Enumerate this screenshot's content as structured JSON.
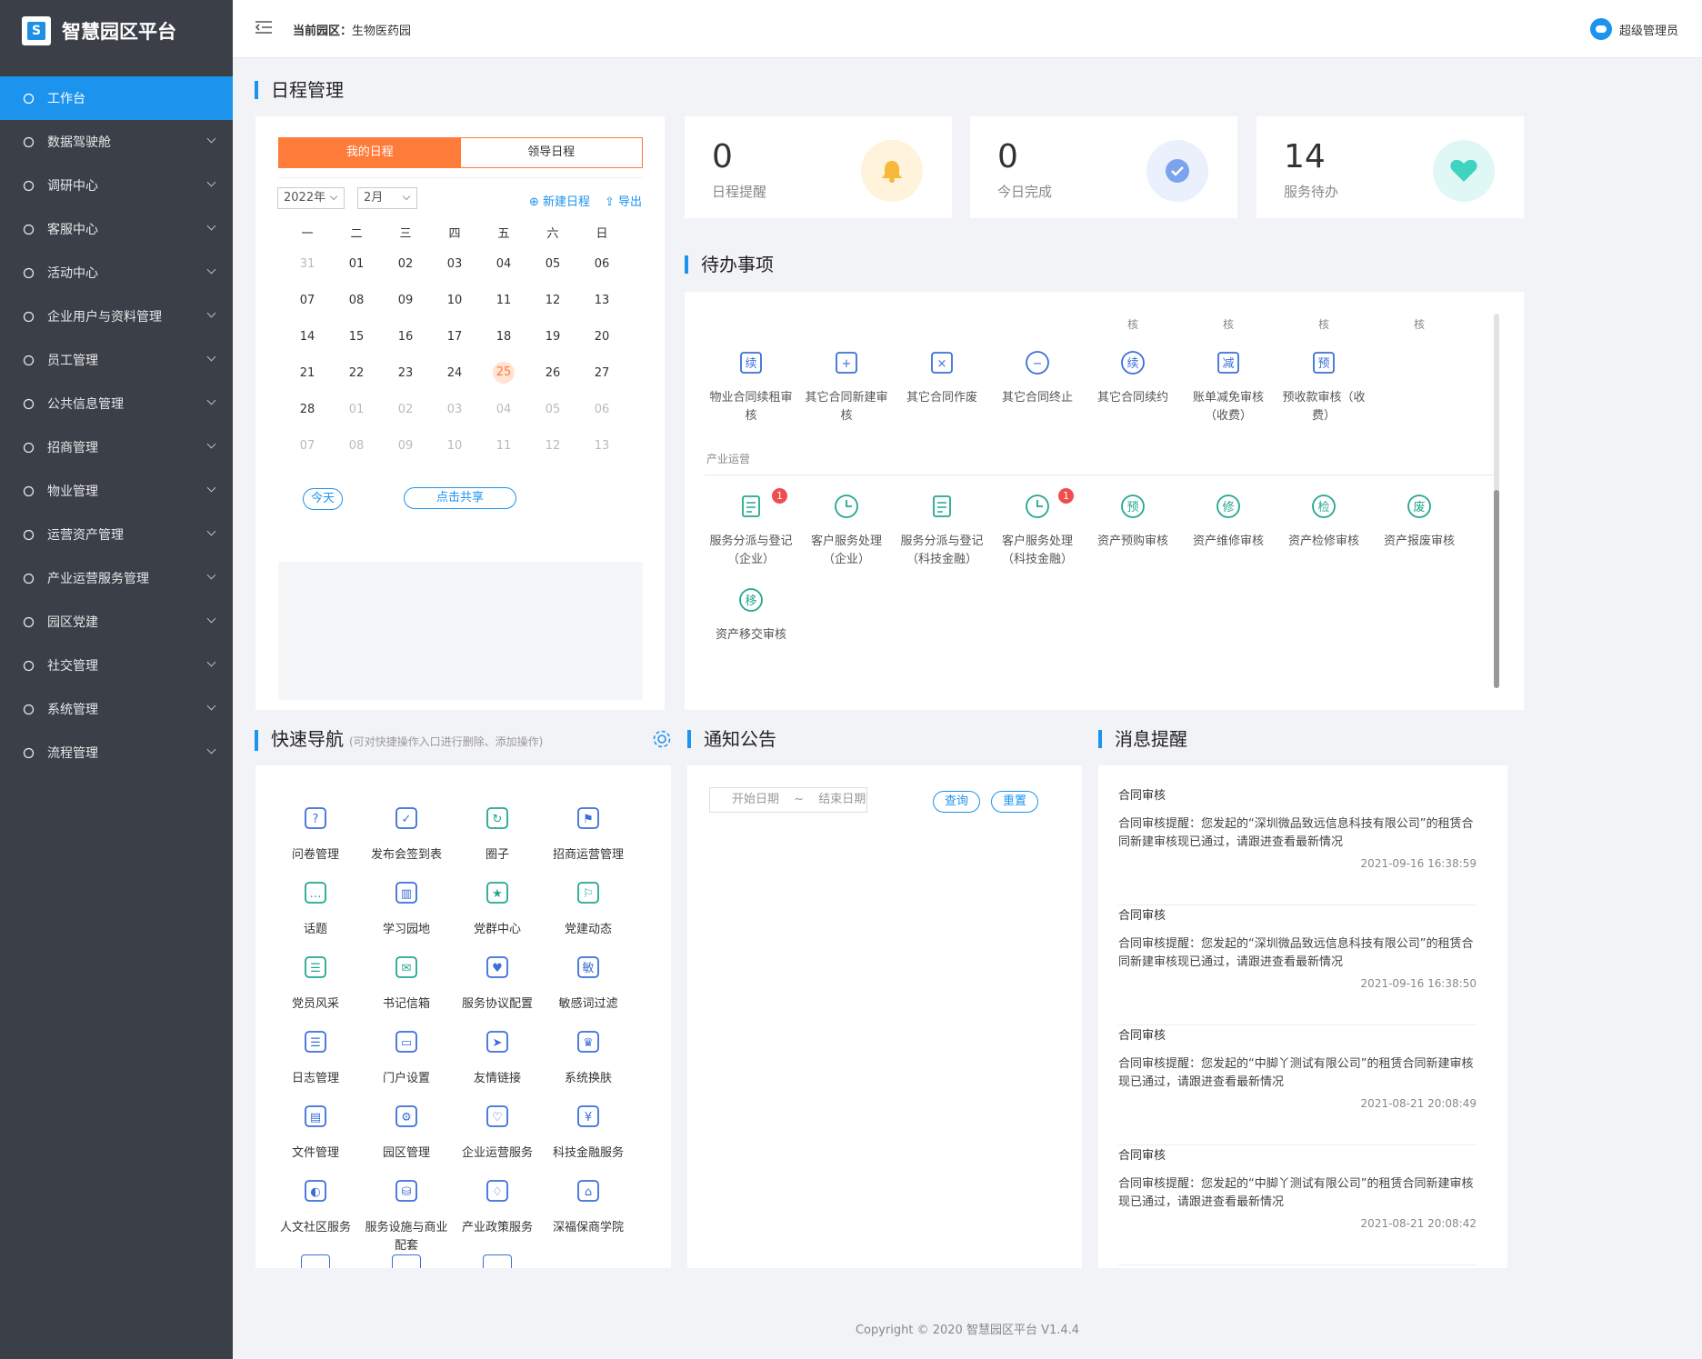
{
  "app": {
    "title": "智慧园区平台",
    "logo_letter": "S"
  },
  "sidebar": {
    "items": [
      {
        "label": "工作台",
        "icon": "dashboard-icon",
        "active": true
      },
      {
        "label": "数据驾驶舱",
        "icon": "bar-chart-icon"
      },
      {
        "label": "调研中心",
        "icon": "search-icon"
      },
      {
        "label": "客服中心",
        "icon": "headset-icon"
      },
      {
        "label": "活动中心",
        "icon": "fire-icon"
      },
      {
        "label": "企业用户与资料管理",
        "icon": "users-icon"
      },
      {
        "label": "员工管理",
        "icon": "user-group-icon"
      },
      {
        "label": "公共信息管理",
        "icon": "network-icon"
      },
      {
        "label": "招商管理",
        "icon": "pie-icon"
      },
      {
        "label": "物业管理",
        "icon": "home-icon"
      },
      {
        "label": "运营资产管理",
        "icon": "coin-icon"
      },
      {
        "label": "产业运营服务管理",
        "icon": "document-icon"
      },
      {
        "label": "园区党建",
        "icon": "org-icon"
      },
      {
        "label": "社交管理",
        "icon": "share-icon"
      },
      {
        "label": "系统管理",
        "icon": "gear-icon"
      },
      {
        "label": "流程管理",
        "icon": "flow-icon"
      }
    ]
  },
  "header": {
    "park_label": "当前园区：",
    "park_name": "生物医药园",
    "user": "超级管理员"
  },
  "schedule": {
    "title": "日程管理",
    "tabs": [
      "我的日程",
      "领导日程"
    ],
    "year": "2022年",
    "month": "2月",
    "new_label": "新建日程",
    "export_label": "导出",
    "weekdays": [
      "一",
      "二",
      "三",
      "四",
      "五",
      "六",
      "日"
    ],
    "weeks": [
      [
        "31",
        "01",
        "02",
        "03",
        "04",
        "05",
        "06"
      ],
      [
        "07",
        "08",
        "09",
        "10",
        "11",
        "12",
        "13"
      ],
      [
        "14",
        "15",
        "16",
        "17",
        "18",
        "19",
        "20"
      ],
      [
        "21",
        "22",
        "23",
        "24",
        "25",
        "26",
        "27"
      ],
      [
        "28",
        "01",
        "02",
        "03",
        "04",
        "05",
        "06"
      ],
      [
        "07",
        "08",
        "09",
        "10",
        "11",
        "12",
        "13"
      ]
    ],
    "today": "25",
    "today_btn": "今天",
    "share_btn": "点击共享"
  },
  "stats": [
    {
      "num": "0",
      "label": "日程提醒",
      "color": "#fff3dc",
      "icon": "bell-icon",
      "iconColor": "#f6b93b"
    },
    {
      "num": "0",
      "label": "今日完成",
      "color": "#eaf1fd",
      "icon": "check-icon",
      "iconColor": "#7ca4ee"
    },
    {
      "num": "14",
      "label": "服务待办",
      "color": "#e0f8f5",
      "icon": "heart-icon",
      "iconColor": "#3fd3c0"
    }
  ],
  "todo": {
    "title": "待办事项",
    "top_labels": [
      "核",
      "核",
      "核",
      "核"
    ],
    "row1": [
      {
        "label": "物业合同续租审核",
        "glyph": "续"
      },
      {
        "label": "其它合同新建审核",
        "glyph": "+"
      },
      {
        "label": "其它合同作废",
        "glyph": "×"
      },
      {
        "label": "其它合同终止",
        "glyph": "−"
      },
      {
        "label": "其它合同续约",
        "glyph": "续"
      },
      {
        "label": "账单减免审核（收费）",
        "glyph": "减"
      },
      {
        "label": "预收款审核（收费）",
        "glyph": "预"
      }
    ],
    "group2": "产业运营",
    "row2": [
      {
        "label": "服务分派与登记（企业）",
        "badge": "1"
      },
      {
        "label": "客户服务处理（企业）"
      },
      {
        "label": "服务分派与登记（科技金融）"
      },
      {
        "label": "客户服务处理（科技金融）",
        "badge": "1"
      },
      {
        "label": "资产预购审核",
        "glyph": "预"
      },
      {
        "label": "资产维修审核",
        "glyph": "修"
      },
      {
        "label": "资产检修审核",
        "glyph": "检"
      },
      {
        "label": "资产报废审核",
        "glyph": "废"
      }
    ],
    "row3": [
      {
        "label": "资产移交审核",
        "glyph": "移"
      }
    ]
  },
  "quicknav": {
    "title": "快速导航",
    "hint": "(可对快捷操作入口进行删除、添加操作)",
    "items": [
      "问卷管理",
      "发布会签到表",
      "圈子",
      "招商运营管理",
      "话题",
      "学习园地",
      "党群中心",
      "党建动态",
      "党员风采",
      "书记信箱",
      "服务协议配置",
      "敏感词过滤",
      "日志管理",
      "门户设置",
      "友情链接",
      "系统换肤",
      "文件管理",
      "园区管理",
      "企业运营服务",
      "科技金融服务",
      "人文社区服务",
      "服务设施与商业配套",
      "产业政策服务",
      "深福保商学院"
    ],
    "colors": [
      "#3b6fd8",
      "#3b6fd8",
      "#22a78f",
      "#3b6fd8",
      "#22a78f",
      "#3b6fd8",
      "#22a78f",
      "#22a78f",
      "#22a78f",
      "#22a78f",
      "#3b6fd8",
      "#3b6fd8",
      "#3b6fd8",
      "#3b6fd8",
      "#3b6fd8",
      "#3b6fd8",
      "#3b6fd8",
      "#3b6fd8",
      "#3b6fd8",
      "#3b6fd8",
      "#3b6fd8",
      "#3b6fd8",
      "#3b6fd8",
      "#3b6fd8"
    ],
    "glyphs": [
      "?",
      "✓",
      "↻",
      "⚑",
      "…",
      "▥",
      "★",
      "⚐",
      "☰",
      "✉",
      "♥",
      "敏",
      "☰",
      "▭",
      "➤",
      "♛",
      "▤",
      "⚙",
      "♡",
      "¥",
      "◐",
      "⛁",
      "♢",
      "⌂"
    ]
  },
  "notice": {
    "title": "通知公告",
    "start_ph": "开始日期",
    "sep": "~",
    "end_ph": "结束日期",
    "query": "查询",
    "reset": "重置"
  },
  "messages": {
    "title": "消息提醒",
    "items": [
      {
        "type": "合同审核",
        "body": "合同审核提醒：您发起的“深圳微品致远信息科技有限公司”的租赁合同新建审核现已通过，请跟进查看最新情况",
        "date": "2021-09-16 16:38:59"
      },
      {
        "type": "合同审核",
        "body": "合同审核提醒：您发起的“深圳微品致远信息科技有限公司”的租赁合同新建审核现已通过，请跟进查看最新情况",
        "date": "2021-09-16 16:38:50"
      },
      {
        "type": "合同审核",
        "body": "合同审核提醒：您发起的“中脚丫测试有限公司”的租赁合同新建审核现已通过，请跟进查看最新情况",
        "date": "2021-08-21 20:08:49"
      },
      {
        "type": "合同审核",
        "body": "合同审核提醒：您发起的“中脚丫测试有限公司”的租赁合同新建审核现已通过，请跟进查看最新情况",
        "date": "2021-08-21 20:08:42"
      }
    ]
  },
  "footer": "Copyright © 2020 智慧园区平台 V1.4.4",
  "accent": "#1c94ee",
  "schedule_accent": "#ff7b3a"
}
